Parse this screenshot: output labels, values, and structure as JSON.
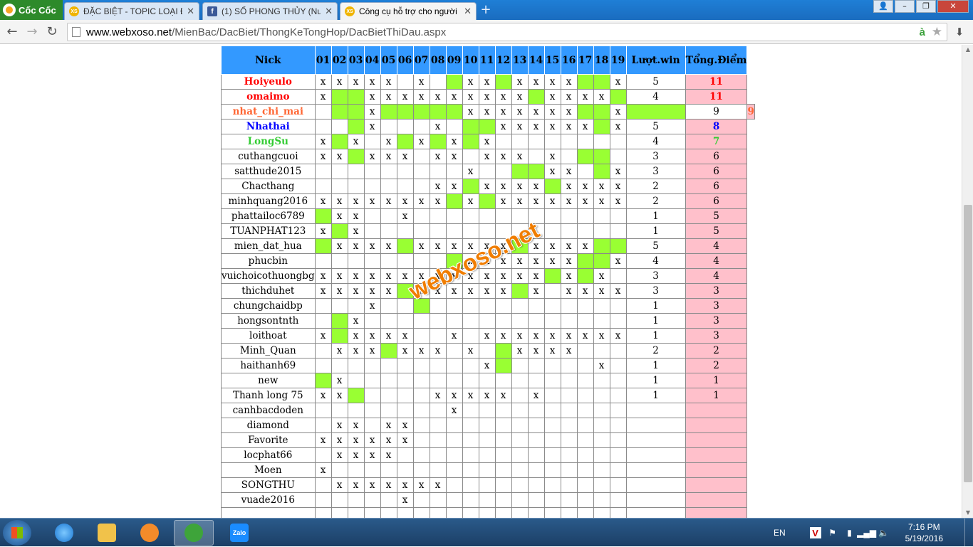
{
  "browser": {
    "brand": "Cốc Cốc",
    "tabs": [
      {
        "label": "ĐẶC BIỆT - TOPIC LOẠI ĐẦ",
        "icon": "xs-icon",
        "active": false
      },
      {
        "label": "(1) SỐ PHONG THỦY (Num",
        "icon": "facebook-icon",
        "active": false
      },
      {
        "label": "Công cụ hỗ trợ cho người",
        "icon": "xs-icon",
        "active": true
      }
    ],
    "url_host": "www.webxoso.net",
    "url_path": "/MienBac/DacBiet/ThongKeTongHop/DacBietThiDau.aspx"
  },
  "table": {
    "headers": {
      "nick": "Nick",
      "days": [
        "01",
        "02",
        "03",
        "04",
        "05",
        "06",
        "07",
        "08",
        "09",
        "10",
        "11",
        "12",
        "13",
        "14",
        "15",
        "16",
        "17",
        "18",
        "19"
      ],
      "wins": "Lượt.win",
      "points": "Tổng.Điểm"
    },
    "colors": {
      "header_bg": "#3399ff",
      "win_cell": "#99ff33",
      "points_bg": "#ffc0cb",
      "rank1": "#ff0000",
      "rank3": "#ff6633",
      "rank4": "#0000ff",
      "rank5": "#33cc33"
    },
    "rows": [
      {
        "nick": "Hoiyeulo",
        "color": "#ff0000",
        "bold": true,
        "cells": "xxxxx.x.gxxgxxxxggx",
        "wins": "5",
        "points": "11"
      },
      {
        "nick": "omaimo",
        "color": "#ff0000",
        "bold": true,
        "cells": "xggxxxxxxxxxxgxxxxg",
        "wins": "4",
        "points": "11"
      },
      {
        "nick": "nhat_chi_mai",
        "color": "#ff6633",
        "bold": true,
        "cells": ".ggxgggggxxxxxxxggxg",
        "wins": "9",
        "points": "9"
      },
      {
        "nick": "Nhathai",
        "color": "#0000ff",
        "bold": true,
        "cells": "..gx...x.ggxxxxxxgx",
        "wins": "5",
        "points": "8"
      },
      {
        "nick": "LongSu",
        "color": "#33cc33",
        "bold": true,
        "cells": "xgx.xgxgxgx........",
        "wins": "4",
        "points": "7"
      },
      {
        "nick": "cuthangcuoi",
        "color": "#000000",
        "bold": false,
        "cells": "xxgxxx.xx.xxx.x.gg.",
        "wins": "3",
        "points": "6"
      },
      {
        "nick": "satthude2015",
        "color": "#000000",
        "bold": false,
        "cells": ".........x..ggxx.gx",
        "wins": "3",
        "points": "6"
      },
      {
        "nick": "Chacthang",
        "color": "#000000",
        "bold": false,
        "cells": ".......xxgxxxxgxxxx",
        "wins": "2",
        "points": "6"
      },
      {
        "nick": "minhquang2016",
        "color": "#000000",
        "bold": false,
        "cells": "xxxxxxxxgxgxxxxxxxx",
        "wins": "2",
        "points": "6"
      },
      {
        "nick": "phattailoc6789",
        "color": "#000000",
        "bold": false,
        "cells": "gxx..x.............",
        "wins": "1",
        "points": "5"
      },
      {
        "nick": "TUANPHAT123",
        "color": "#000000",
        "bold": false,
        "cells": "xgx................",
        "wins": "1",
        "points": "5"
      },
      {
        "nick": "mien_dat_hua",
        "color": "#000000",
        "bold": false,
        "cells": "gxxxxgxxxxxxgxxxxgg",
        "wins": "5",
        "points": "4"
      },
      {
        "nick": "phucbin",
        "color": "#000000",
        "bold": false,
        "cells": "........gxxxxxxxggx",
        "wins": "4",
        "points": "4"
      },
      {
        "nick": "vuichoicothuongbg",
        "color": "#000000",
        "bold": false,
        "cells": "xxxxxxxxxxxxxxgxgx.",
        "wins": "3",
        "points": "4"
      },
      {
        "nick": "thichduhet",
        "color": "#000000",
        "bold": false,
        "cells": "xxxxxgxxxxxxgx.xxxx",
        "wins": "3",
        "points": "3"
      },
      {
        "nick": "chungchaidbp",
        "color": "#000000",
        "bold": false,
        "cells": "...x..g............",
        "wins": "1",
        "points": "3"
      },
      {
        "nick": "hongsontnth",
        "color": "#000000",
        "bold": false,
        "cells": ".gx................",
        "wins": "1",
        "points": "3"
      },
      {
        "nick": "loithoat",
        "color": "#000000",
        "bold": false,
        "cells": "xgxxxx..x.xxxxxxxxx",
        "wins": "1",
        "points": "3"
      },
      {
        "nick": "Minh_Quan",
        "color": "#000000",
        "bold": false,
        "cells": ".xxxgxxx.x.gxxxx...",
        "wins": "2",
        "points": "2"
      },
      {
        "nick": "haithanh69",
        "color": "#000000",
        "bold": false,
        "cells": "..........xg.....x.",
        "wins": "1",
        "points": "2"
      },
      {
        "nick": "new",
        "color": "#000000",
        "bold": false,
        "cells": "gx.................",
        "wins": "1",
        "points": "1"
      },
      {
        "nick": "Thanh long 75",
        "color": "#000000",
        "bold": false,
        "cells": "xxg....xxxxx.x.....",
        "wins": "1",
        "points": "1"
      },
      {
        "nick": "canhbacdoden",
        "color": "#000000",
        "bold": false,
        "cells": "........x..........",
        "wins": "",
        "points": ""
      },
      {
        "nick": "diamond",
        "color": "#000000",
        "bold": false,
        "cells": ".xx.xx.............",
        "wins": "",
        "points": ""
      },
      {
        "nick": "Favorite",
        "color": "#000000",
        "bold": false,
        "cells": "xxxxxx.............",
        "wins": "",
        "points": ""
      },
      {
        "nick": "locphat66",
        "color": "#000000",
        "bold": false,
        "cells": ".xxxx..............",
        "wins": "",
        "points": ""
      },
      {
        "nick": "Moen",
        "color": "#000000",
        "bold": false,
        "cells": "x..................",
        "wins": "",
        "points": ""
      },
      {
        "nick": "SONGTHU",
        "color": "#000000",
        "bold": false,
        "cells": ".xxxxxxx...........",
        "wins": "",
        "points": ""
      },
      {
        "nick": "vuade2016",
        "color": "#000000",
        "bold": false,
        "cells": ".....x.............",
        "wins": "",
        "points": ""
      },
      {
        "nick": "",
        "color": "#000000",
        "bold": false,
        "cells": "...................",
        "wins": "",
        "points": ""
      }
    ]
  },
  "watermark": "webxoso.net",
  "taskbar": {
    "apps": [
      "internet-explorer-icon",
      "file-explorer-icon",
      "media-player-icon",
      "coccoc-browser-icon",
      "zalo-icon"
    ],
    "zalo_label": "Zalo",
    "language": "EN",
    "time": "7:16 PM",
    "date": "5/19/2016"
  }
}
